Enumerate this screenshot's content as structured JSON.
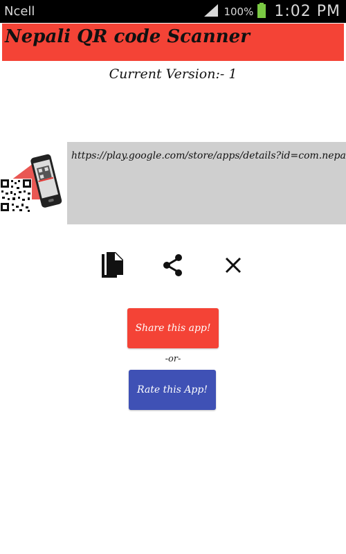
{
  "status_bar": {
    "carrier": "Ncell",
    "battery_percent": "100%",
    "time": "1:02 PM"
  },
  "app": {
    "title": "Nepali QR code Scanner",
    "version_text": "Current Version:- 1"
  },
  "result": {
    "text": "https://play.google.com/store/apps/details?id=com.nepal"
  },
  "actions": {
    "copy_icon": "copy-icon",
    "share_icon": "share-icon",
    "close_icon": "close-icon"
  },
  "buttons": {
    "share_label": "Share this app!",
    "or_text": "-or-",
    "rate_label": "Rate this App!"
  },
  "colors": {
    "title_bg": "#f44336",
    "share_button": "#f44336",
    "rate_button": "#3f51b5",
    "result_bg": "#cfcfcf"
  }
}
